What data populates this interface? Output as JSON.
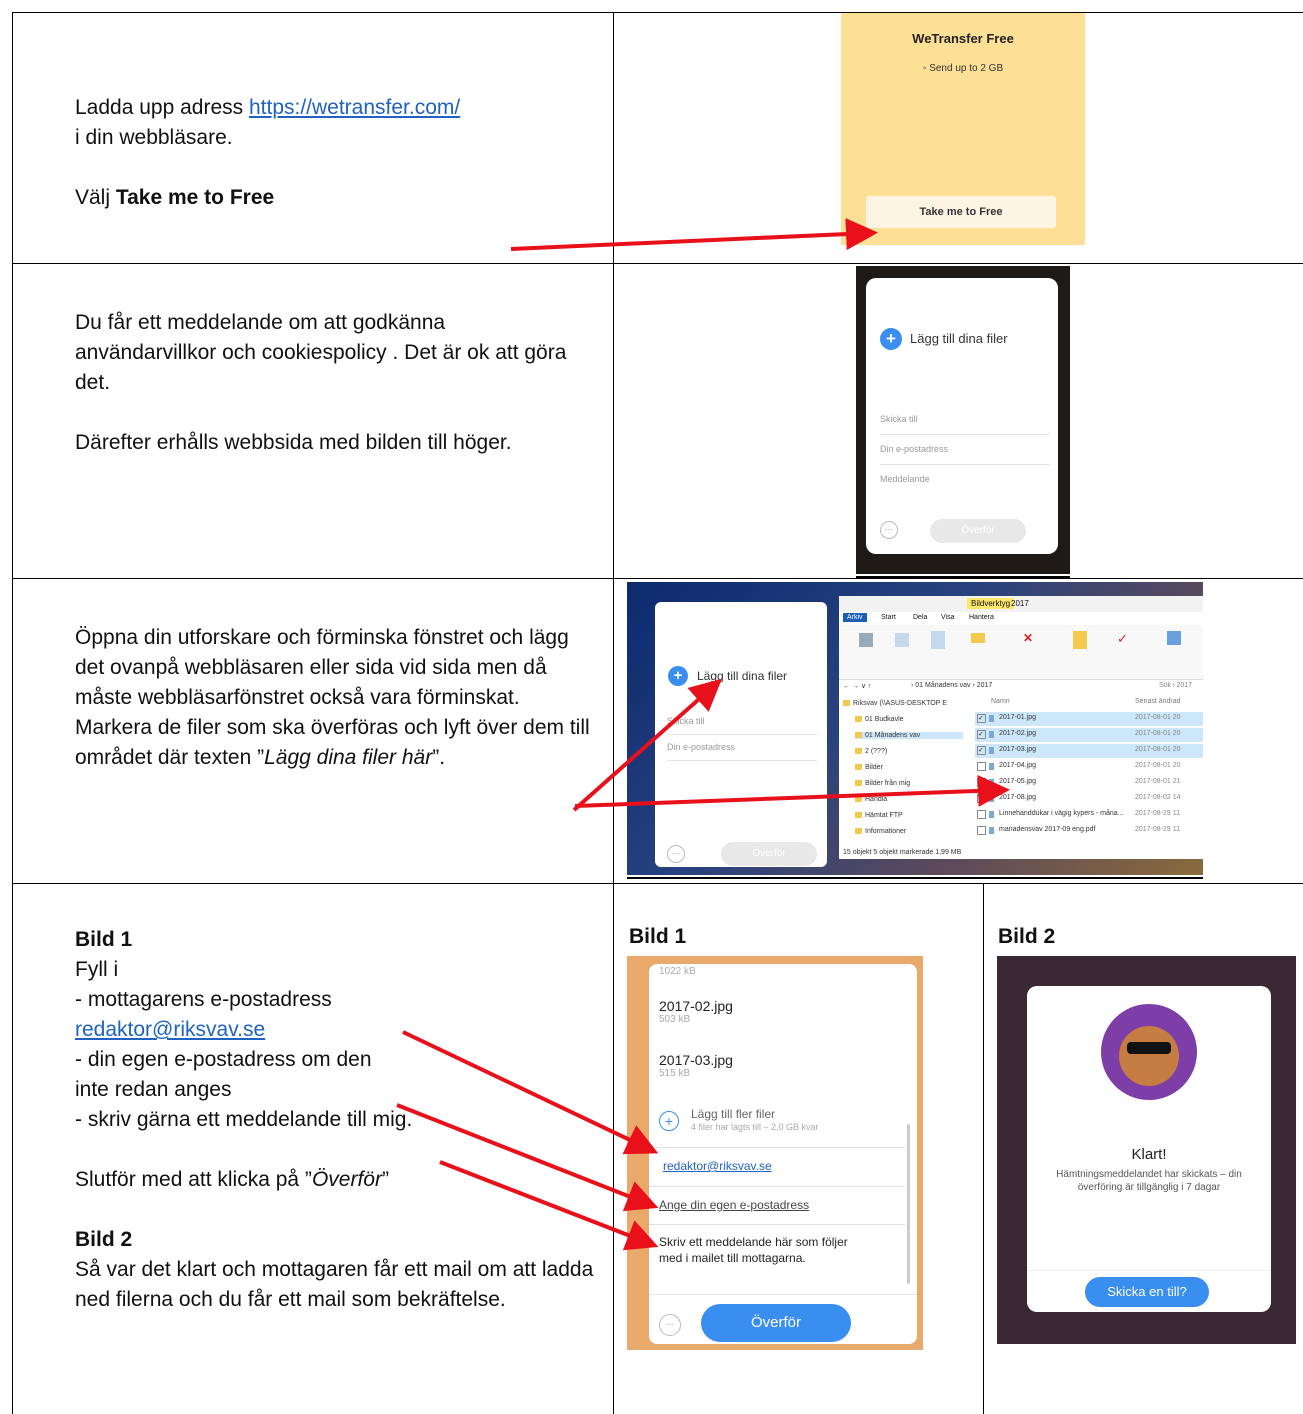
{
  "row1": {
    "line1_prefix": "Ladda upp adress ",
    "link": "https://wetransfer.com/",
    "line2": "i din webbläsare.",
    "choose_prefix": "Välj ",
    "choose_bold": "Take me to Free",
    "screenshot": {
      "title": "WeTransfer Free",
      "subtitle": "Send up to 2 GB",
      "button": "Take me to Free"
    }
  },
  "row2": {
    "para1": "Du får ett meddelande om att godkänna användarvillkor och cookiespolicy . Det är ok att göra det.",
    "para2": "Därefter erhålls webbsida med bilden till höger.",
    "screenshot": {
      "add_files": "Lägg till dina filer",
      "send_to": "Skicka till",
      "your_email": "Din e-postadress",
      "message": "Meddelande",
      "transfer": "Överför"
    }
  },
  "row3": {
    "para1": "Öppna din utforskare och förminska fönstret och lägg det ovanpå webbläsaren eller sida vid sida men då måste webbläsarfönstret också vara förminskat.",
    "para2_prefix": "Markera de filer som ska överföras och lyft över dem till området där texten ”",
    "para2_italic": "Lägg dina filer här",
    "para2_suffix": "”.",
    "screenshot": {
      "add_files": "Lägg till dina filer",
      "send_to": "Skicka till",
      "your_email": "Din e-postadress",
      "transfer": "Överför",
      "ribbon_tabs": [
        "Arkiv",
        "Start",
        "Dela",
        "Visa",
        "Hantera"
      ],
      "highlight_tab": "Bildverktyg",
      "window_title": "2017",
      "breadcrumb": "› 01 Månadens vav › 2017",
      "search": "Sök i 2017",
      "col_name": "Namn",
      "col_date": "Senast ändrad",
      "folders": [
        "Riksvav (\\\\ASUS-DESKTOP E",
        "01 Budkavle",
        "01 Månadens vav",
        "2 (???)",
        "Bilder",
        "Bilder från mig",
        "Handla",
        "Hämtat FTP",
        "Informationer"
      ],
      "files": [
        {
          "name": "2017-01.jpg",
          "date": "2017-08-01 20",
          "selected": true
        },
        {
          "name": "2017-02.jpg",
          "date": "2017-08-01 20",
          "selected": true
        },
        {
          "name": "2017-03.jpg",
          "date": "2017-08-01 20",
          "selected": true
        },
        {
          "name": "2017-04.jpg",
          "date": "2017-08-01 20",
          "selected": false
        },
        {
          "name": "2017-05.jpg",
          "date": "2017-08-01 21",
          "selected": false
        },
        {
          "name": "2017-08.jpg",
          "date": "2017-08-02 14",
          "selected": false
        },
        {
          "name": "Linnehanddukar i vägig kypers - måna...",
          "date": "2017-08-29 11",
          "selected": false
        },
        {
          "name": "manadensvav 2017-09 eng.pdf",
          "date": "2017-08-29 11",
          "selected": false
        }
      ],
      "status": "15 objekt    5 objekt markerade  1,99 MB"
    }
  },
  "row4": {
    "bild1_heading": "Bild 1",
    "fill_in": "Fyll i",
    "item1": "- mottagarens e-postadress",
    "email_link": "redaktor@riksvav.se",
    "item2a": "- din egen e-postadress om den",
    "item2b": "inte redan anges",
    "item3": "- skriv gärna ett meddelande till mig.",
    "finish_prefix": "Slutför med att klicka på ”",
    "finish_italic": "Överför",
    "finish_suffix": "”",
    "bild2_heading": "Bild 2",
    "bild2_text": "Så var det klart och mottagaren får ett mail om att ladda ned filerna och du får ett mail som bekräftelse.",
    "bild1_label": "Bild 1",
    "bild2_label": "Bild 2",
    "bild1_shot": {
      "size_top": "1022 kB",
      "files": [
        {
          "name": "2017-02.jpg",
          "size": "503 kB"
        },
        {
          "name": "2017-03.jpg",
          "size": "515 kB"
        }
      ],
      "add_more": "Lägg till fler filer",
      "add_more_sub": "4 filer har lagts till – 2,0 GB kvar",
      "recipient": "redaktor@riksvav.se",
      "own_email": "Ange din egen e-postadress",
      "message": "Skriv ett meddelande här som följer med i mailet till mottagarna.",
      "transfer": "Överför"
    },
    "bild2_shot": {
      "title": "Klart!",
      "message": "Hämtningsmeddelandet har skickats – din överföring är tillgänglig i 7 dagar",
      "button": "Skicka en till?"
    }
  },
  "colors": {
    "arrow": "#e8101a",
    "link": "#1f62c2",
    "wetransfer_yellow": "#fde096",
    "accent_blue": "#3a8ef0"
  }
}
